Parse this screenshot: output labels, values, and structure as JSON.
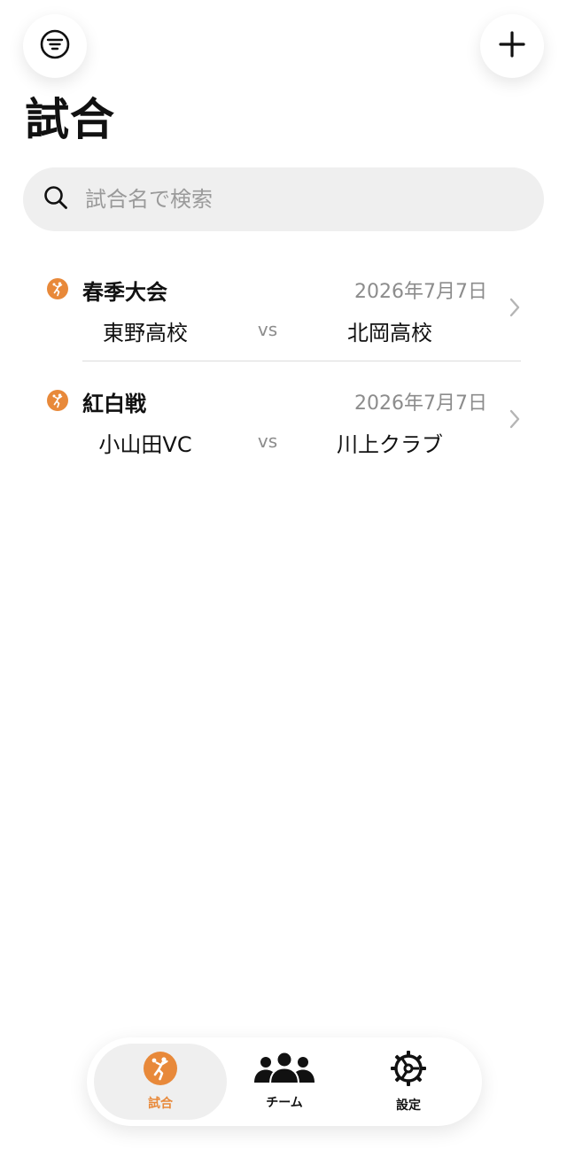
{
  "header": {
    "title": "試合",
    "filter_icon": "filter-lines-icon",
    "add_icon": "plus-icon"
  },
  "search": {
    "placeholder": "試合名で検索",
    "value": ""
  },
  "matches": [
    {
      "name": "春季大会",
      "date": "2026年7月7日",
      "home": "東野高校",
      "vs": "vs",
      "away": "北岡高校",
      "icon": "volleyball-player-icon"
    },
    {
      "name": "紅白戦",
      "date": "2026年7月7日",
      "home": "小山田VC",
      "vs": "vs",
      "away": "川上クラブ",
      "icon": "volleyball-player-icon"
    }
  ],
  "tabs": [
    {
      "label": "試合",
      "icon": "volleyball-player-icon",
      "active": true
    },
    {
      "label": "チーム",
      "icon": "people-icon",
      "active": false
    },
    {
      "label": "設定",
      "icon": "gear-icon",
      "active": false
    }
  ],
  "colors": {
    "accent": "#e8893a",
    "secondary_text": "#8c8c8c",
    "search_bg": "#efefef"
  }
}
